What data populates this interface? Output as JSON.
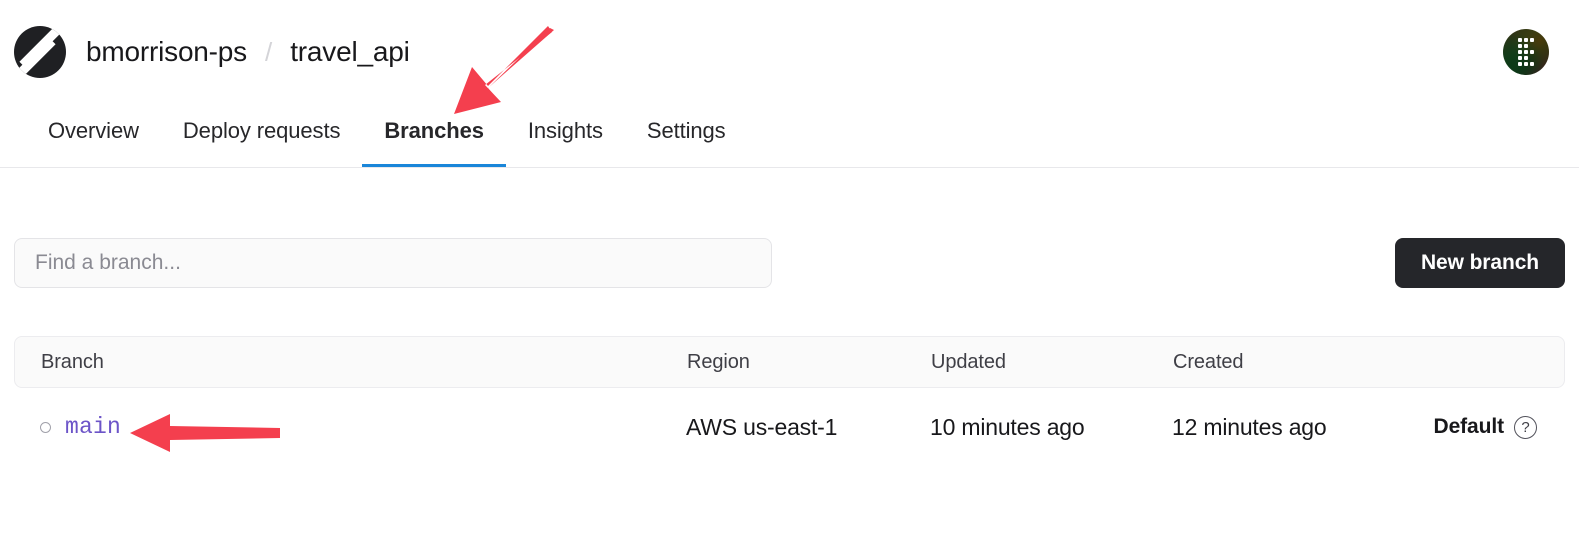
{
  "header": {
    "logo_icon": "planetscale-logo-icon",
    "organization": "bmorrison-ps",
    "separator": "/",
    "database": "travel_api",
    "avatar_icon": "user-avatar"
  },
  "nav": {
    "tabs": [
      {
        "label": "Overview",
        "active": false
      },
      {
        "label": "Deploy requests",
        "active": false
      },
      {
        "label": "Branches",
        "active": true
      },
      {
        "label": "Insights",
        "active": false
      },
      {
        "label": "Settings",
        "active": false
      }
    ],
    "active_underline_color": "#1a86d9"
  },
  "toolbar": {
    "search_placeholder": "Find a branch...",
    "search_value": "",
    "new_branch_label": "New branch",
    "new_branch_bg": "#25262a"
  },
  "table": {
    "columns": [
      "Branch",
      "Region",
      "Updated",
      "Created"
    ],
    "rows": [
      {
        "branch": "main",
        "branch_color": "#6c54c8",
        "region": "AWS us-east-1",
        "updated": "10 minutes ago",
        "created": "12 minutes ago",
        "badge": "Default",
        "help_icon": "?"
      }
    ]
  },
  "annotations": {
    "arrow_color": "#f43f4e",
    "arrow_to_branches_tab": "arrow pointing down-left at Branches tab",
    "arrow_to_main_branch": "arrow pointing left at main branch row"
  }
}
